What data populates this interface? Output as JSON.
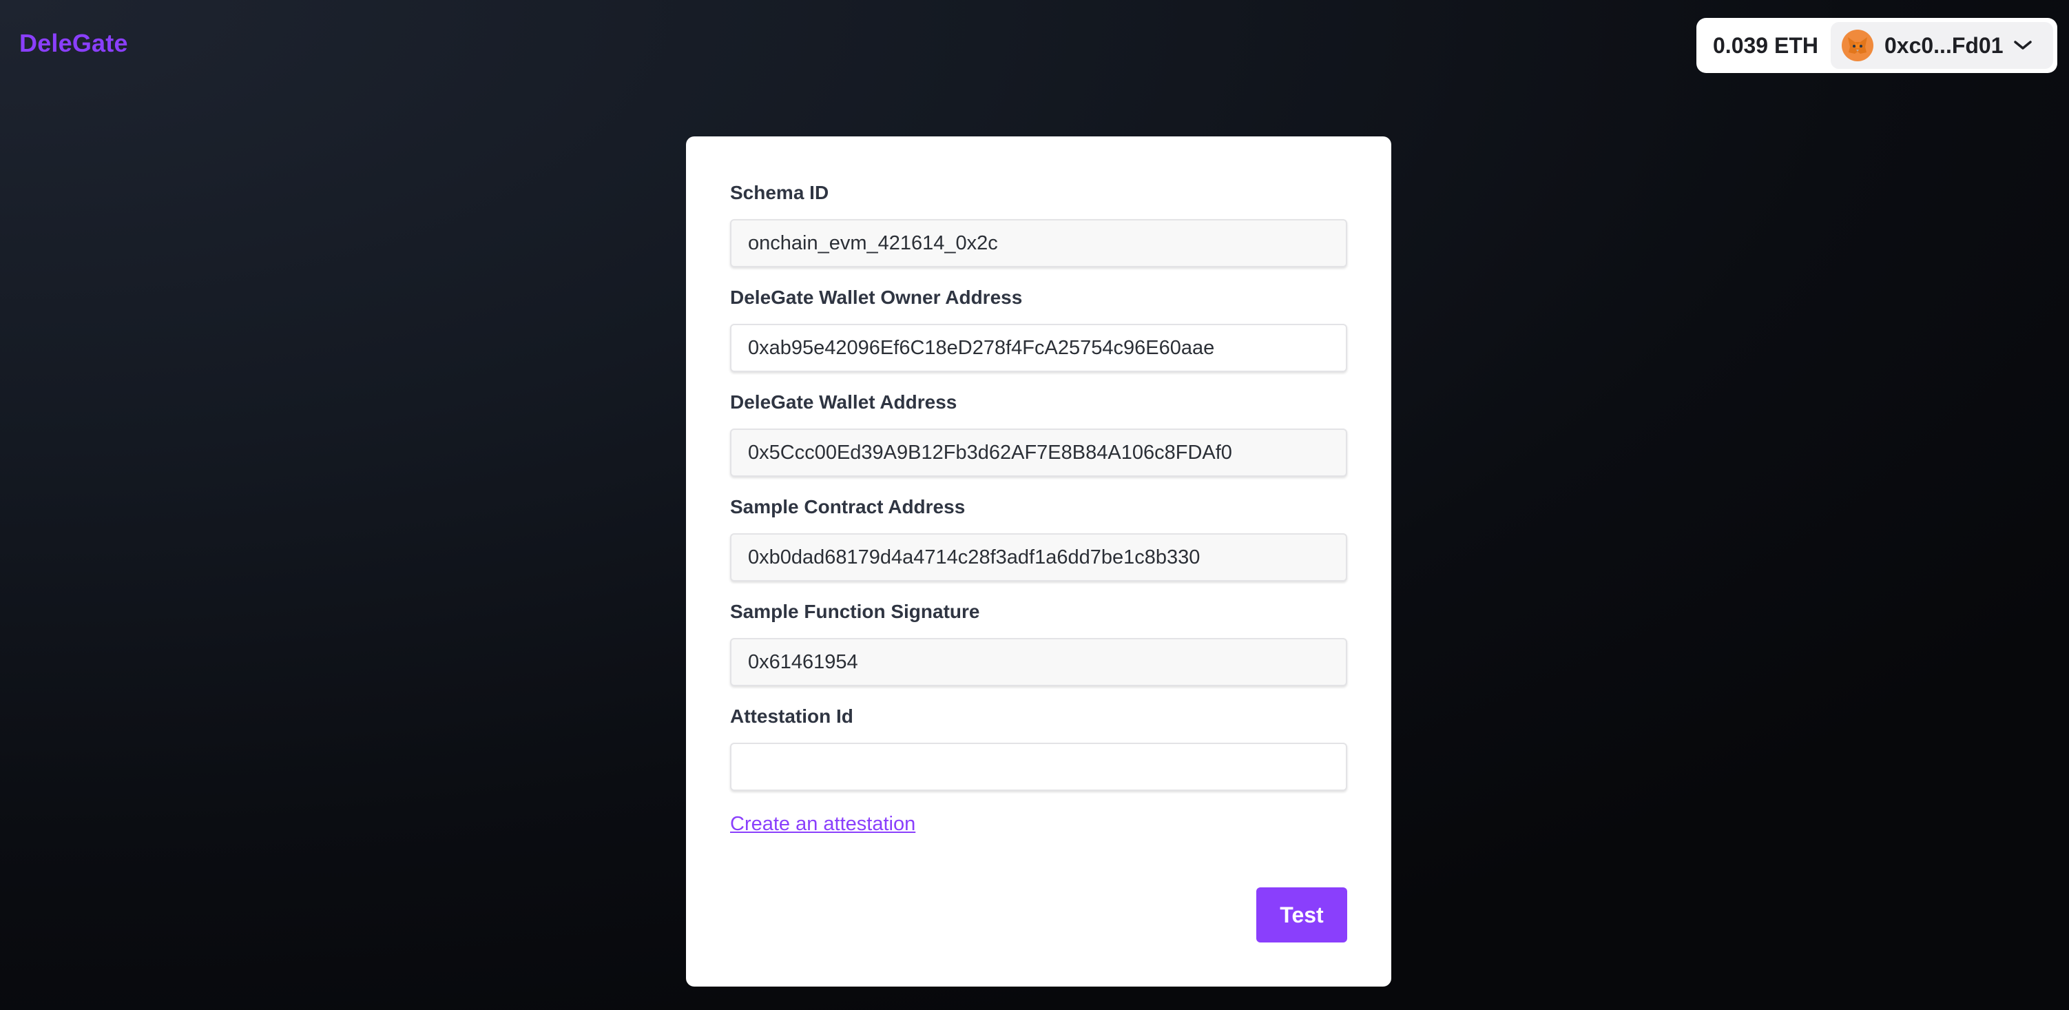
{
  "app": {
    "logo": "DeleGate"
  },
  "wallet": {
    "balance": "0.039 ETH",
    "address": "0xc0...Fd01",
    "avatar_icon": "metamask-fox-icon",
    "dropdown_icon": "chevron-down-icon"
  },
  "form": {
    "fields": [
      {
        "label": "Schema ID",
        "value": "onchain_evm_421614_0x2c",
        "placeholder": ""
      },
      {
        "label": "DeleGate Wallet Owner Address",
        "value": "0xab95e42096Ef6C18eD278f4FcA25754c96E60aae",
        "placeholder": ""
      },
      {
        "label": "DeleGate Wallet Address",
        "value": "0x5Ccc00Ed39A9B12Fb3d62AF7E8B84A106c8FDAf0",
        "placeholder": ""
      },
      {
        "label": "Sample Contract Address",
        "value": "0xb0dad68179d4a4714c28f3adf1a6dd7be1c8b330",
        "placeholder": ""
      },
      {
        "label": "Sample Function Signature",
        "value": "0x61461954",
        "placeholder": ""
      },
      {
        "label": "Attestation Id",
        "value": "",
        "placeholder": ""
      }
    ],
    "create_link": "Create an attestation",
    "submit_label": "Test"
  },
  "colors": {
    "accent": "#8a3ffc",
    "card_background": "#ffffff",
    "page_background": "#141922"
  }
}
